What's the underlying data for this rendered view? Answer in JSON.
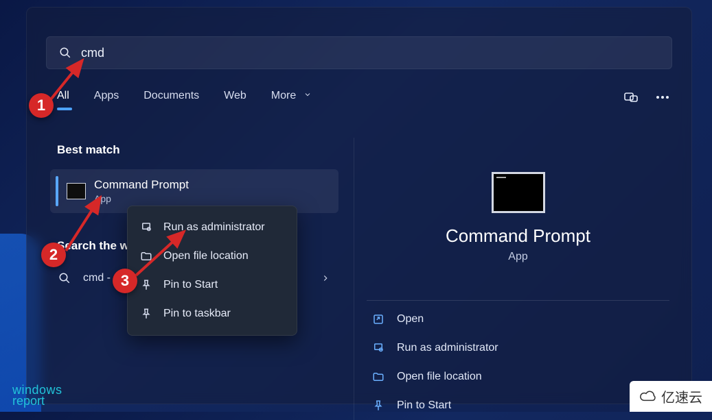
{
  "search": {
    "value": "cmd"
  },
  "tabs": {
    "items": [
      "All",
      "Apps",
      "Documents",
      "Web",
      "More"
    ],
    "active": 0
  },
  "sections": {
    "best_match": "Best match",
    "search_web": "Search the web"
  },
  "best_result": {
    "title": "Command Prompt",
    "subtitle": "App"
  },
  "web_result": {
    "label": "cmd -"
  },
  "context_menu": {
    "items": [
      {
        "icon": "admin",
        "label": "Run as administrator"
      },
      {
        "icon": "folder",
        "label": "Open file location"
      },
      {
        "icon": "pin-start",
        "label": "Pin to Start"
      },
      {
        "icon": "pin-taskbar",
        "label": "Pin to taskbar"
      }
    ]
  },
  "preview": {
    "title": "Command Prompt",
    "subtitle": "App"
  },
  "actions": {
    "items": [
      {
        "icon": "open",
        "label": "Open"
      },
      {
        "icon": "admin",
        "label": "Run as administrator"
      },
      {
        "icon": "folder",
        "label": "Open file location"
      },
      {
        "icon": "pin-start",
        "label": "Pin to Start"
      }
    ]
  },
  "badges": {
    "b1": "1",
    "b2": "2",
    "b3": "3"
  },
  "watermark": {
    "l1": "windows",
    "l2": "report"
  },
  "corner": {
    "text": "亿速云"
  }
}
